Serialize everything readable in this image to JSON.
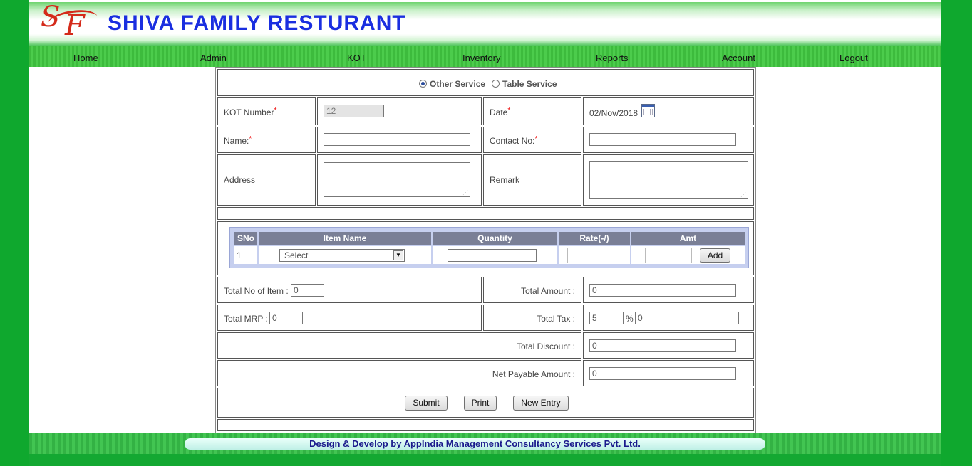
{
  "brand": {
    "logo_letters": "SF",
    "title": "SHIVA FAMILY RESTURANT"
  },
  "nav": {
    "items": [
      "Home",
      "Admin",
      "KOT",
      "Inventory",
      "Reports",
      "Account",
      "Logout"
    ]
  },
  "service": {
    "options": [
      "Other Service",
      "Table Service"
    ],
    "selected": "Other Service"
  },
  "fields": {
    "kot_number_label": "KOT Number",
    "kot_number_value": "12",
    "date_label": "Date",
    "date_value": "02/Nov/2018",
    "name_label": "Name:",
    "contact_label": "Contact No:",
    "address_label": "Address",
    "remark_label": "Remark",
    "required_mark": "*"
  },
  "items_table": {
    "headers": [
      "SNo",
      "Item Name",
      "Quantity",
      "Rate(-/)",
      "Amt"
    ],
    "row": {
      "sno": "1",
      "item_select": "Select",
      "add_label": "Add"
    }
  },
  "totals": {
    "total_no_items_label": "Total No of Item :",
    "total_no_items_value": "0",
    "total_amount_label": "Total Amount :",
    "total_amount_value": "0",
    "total_mrp_label": "Total MRP :",
    "total_mrp_value": "0",
    "total_tax_label": "Total Tax :",
    "tax_percent_value": "5",
    "percent_sign": "%",
    "tax_amount_value": "0",
    "total_discount_label": "Total Discount :",
    "total_discount_value": "0",
    "net_payable_label": "Net Payable Amount :",
    "net_payable_value": "0"
  },
  "actions": {
    "submit": "Submit",
    "print": "Print",
    "new_entry": "New Entry"
  },
  "footer": {
    "text": "Design & Develop by AppIndia Management Consultancy Services Pvt. Ltd."
  },
  "colors": {
    "frame_green": "#0fa82e",
    "title_blue": "#1a2ee0",
    "logo_red": "#d42a1a",
    "grid_header": "#7a7f96",
    "footer_text": "#1a1a8c"
  }
}
